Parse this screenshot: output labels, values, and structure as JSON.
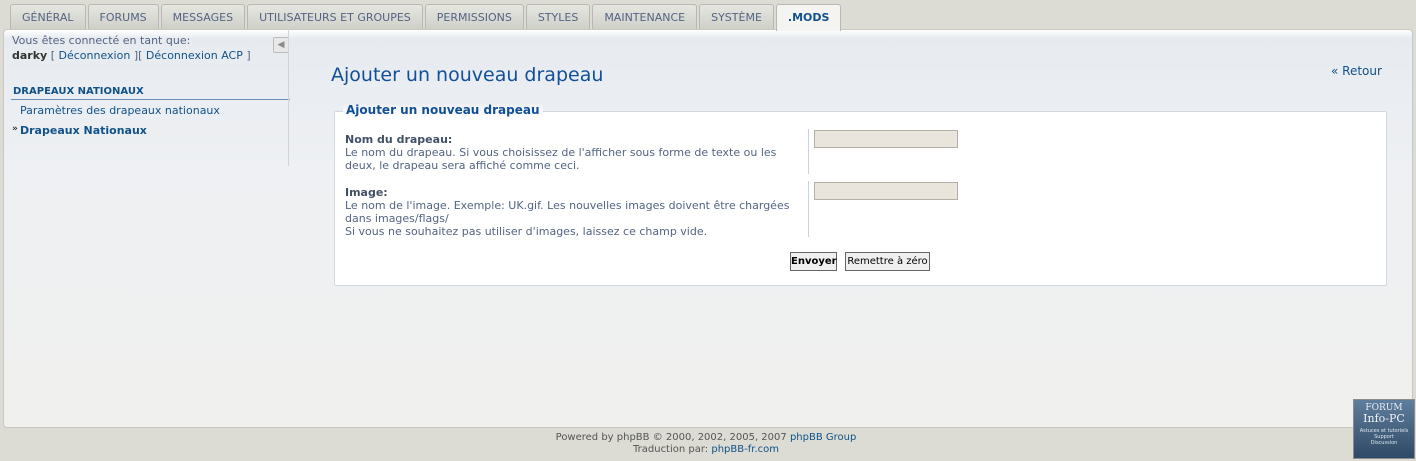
{
  "tabs": [
    {
      "label": "GÉNÉRAL"
    },
    {
      "label": "FORUMS"
    },
    {
      "label": "MESSAGES"
    },
    {
      "label": "UTILISATEURS ET GROUPES"
    },
    {
      "label": "PERMISSIONS"
    },
    {
      "label": "STYLES"
    },
    {
      "label": "MAINTENANCE"
    },
    {
      "label": "SYSTÈME"
    },
    {
      "label": ".MODS"
    }
  ],
  "sidebar": {
    "login_text": "Vous êtes connecté en tant que:",
    "username": "darky",
    "logout_label": "Déconnexion",
    "logout_acp_label": "Déconnexion ACP",
    "section_title": "DRAPEAUX NATIONAUX",
    "items": [
      {
        "label": "Paramètres des drapeaux nationaux"
      },
      {
        "label": "Drapeaux Nationaux"
      }
    ]
  },
  "main": {
    "title": "Ajouter un nouveau drapeau",
    "back_label": "« Retour",
    "legend": "Ajouter un nouveau drapeau",
    "fields": [
      {
        "label": "Nom du drapeau:",
        "explain": "Le nom du drapeau. Si vous choisissez de l'afficher sous forme de texte ou les deux, le drapeau sera affiché comme ceci.",
        "value": ""
      },
      {
        "label": "Image:",
        "explain": "Le nom de l'image. Exemple: UK.gif. Les nouvelles images doivent être chargées dans images/flags/",
        "explain2": "Si vous ne souhaitez pas utiliser d'images, laissez ce champ vide.",
        "value": ""
      }
    ],
    "submit_label": "Envoyer",
    "reset_label": "Remettre à zéro"
  },
  "footer": {
    "powered_text": "Powered by phpBB © 2000, 2002, 2005, 2007",
    "powered_link": "phpBB Group",
    "translation_text": "Traduction par:",
    "translation_link": "phpBB-fr.com"
  },
  "badge": {
    "line1": "FORUM",
    "line2": "Info-PC",
    "line3": "Astuces et tutoriels",
    "line4": "Support",
    "line5": "Discussion"
  }
}
